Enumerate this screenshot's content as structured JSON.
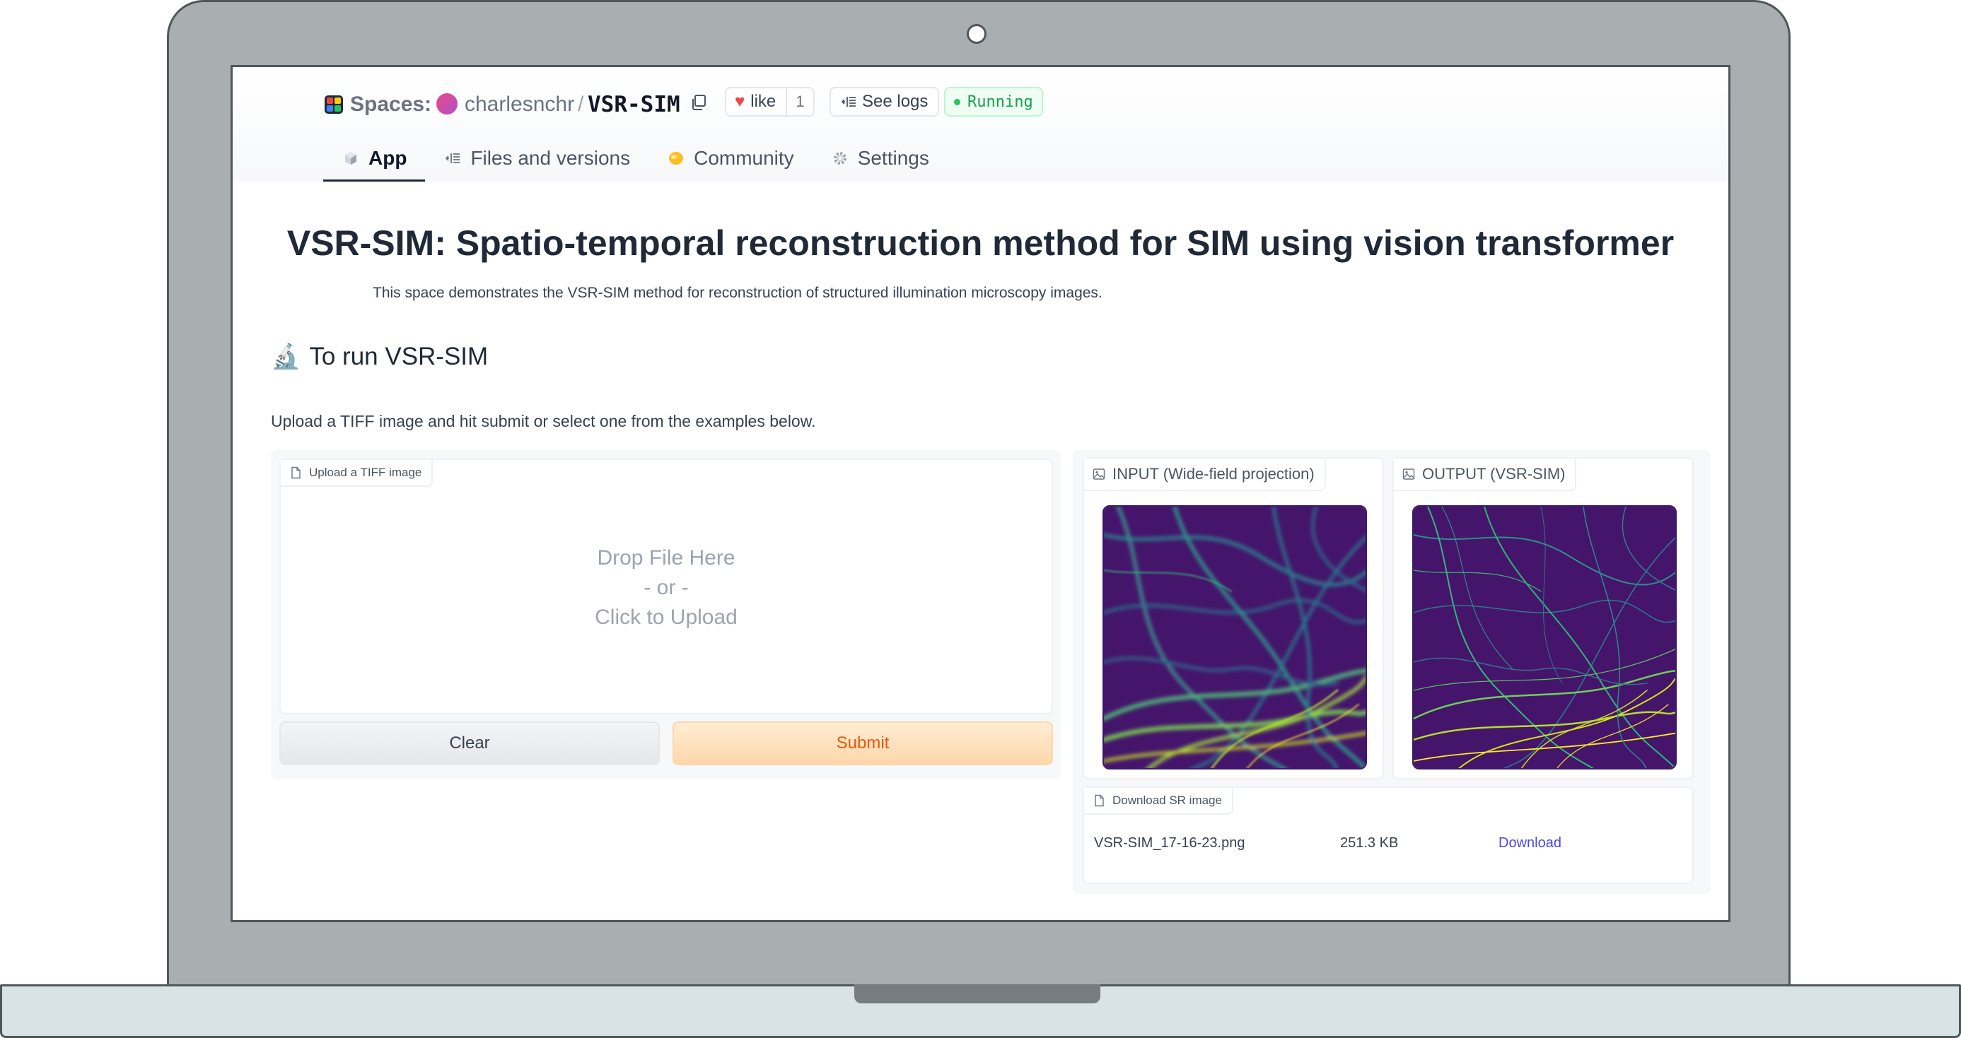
{
  "header": {
    "spaces_label": "Spaces:",
    "owner": "charlesnchr",
    "separator": "/",
    "repo": "VSR-SIM",
    "like_label": "like",
    "like_count": "1",
    "logs_label": "See logs",
    "status": "Running",
    "status_color": "#16a34a"
  },
  "tabs": [
    {
      "label": "App",
      "icon": "cube-icon",
      "active": true
    },
    {
      "label": "Files and versions",
      "icon": "files-icon",
      "active": false
    },
    {
      "label": "Community",
      "icon": "community-icon",
      "active": false
    },
    {
      "label": "Settings",
      "icon": "gear-icon",
      "active": false
    }
  ],
  "main": {
    "title": "VSR-SIM: Spatio-temporal reconstruction method for SIM using vision transformer",
    "description": "This space demonstrates the VSR-SIM method for reconstruction of structured illumination microscopy images.",
    "section_heading": "To run VSR-SIM",
    "section_icon": "🔬",
    "instructions": "Upload a TIFF image and hit submit or select one from the examples below."
  },
  "upload": {
    "label": "Upload a TIFF image",
    "drop_line1": "Drop File Here",
    "drop_line2": "- or -",
    "drop_line3": "Click to Upload"
  },
  "buttons": {
    "clear": "Clear",
    "submit": "Submit",
    "submit_color": "#ea580c"
  },
  "outputs": {
    "input_label": "INPUT (Wide-field projection)",
    "output_label": "OUTPUT (VSR-SIM)",
    "download_label": "Download SR image",
    "file_name": "VSR-SIM_17-16-23.png",
    "file_size": "251.3 KB",
    "download_link": "Download"
  },
  "colors": {
    "accent_orange": "#fb923c",
    "viridis_background": "#44156b",
    "link": "#4f46e5"
  }
}
